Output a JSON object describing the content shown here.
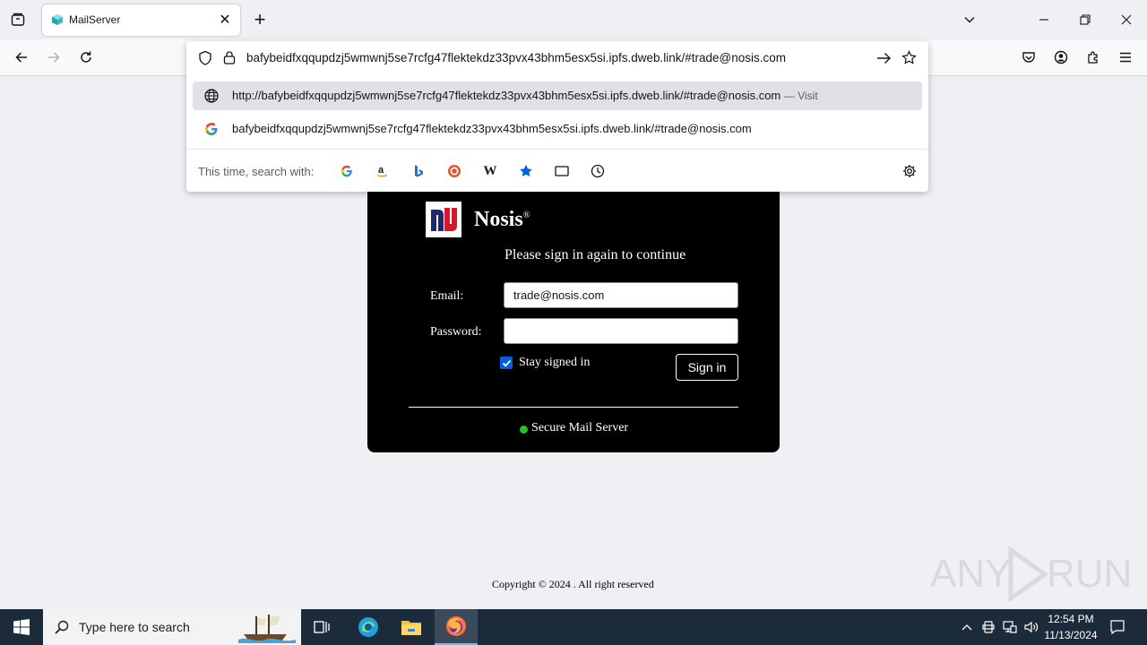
{
  "browser": {
    "tab": {
      "title": "MailServer",
      "close_glyph": "✕"
    },
    "new_tab_glyph": "+",
    "url": "bafybeidfxqqupdzj5wmwnj5se7rcfg47flektekdz33pvx43bhm5esx5si.ipfs.dweb.link/#trade@nosis.com",
    "suggestions": [
      {
        "text": "http://bafybeidfxqqupdzj5wmwnj5se7rcfg47flektekdz33pvx43bhm5esx5si.ipfs.dweb.link/#trade@nosis.com",
        "action": "— Visit",
        "icon": "globe-icon"
      },
      {
        "text": "bafybeidfxqqupdzj5wmwnj5se7rcfg47flektekdz33pvx43bhm5esx5si.ipfs.dweb.link/#trade@nosis.com",
        "icon": "google-icon"
      }
    ],
    "search_with_label": "This time, search with:",
    "search_engines": [
      "google-icon",
      "amazon-icon",
      "bing-icon",
      "duckduckgo-icon",
      "wikipedia-icon",
      "bookmarks-icon",
      "tabs-icon",
      "history-icon"
    ],
    "wikipedia_glyph": "W"
  },
  "page": {
    "brand": "Nosis",
    "brand_mark": "®",
    "subtitle": "Please sign in again to continue",
    "email_label": "Email:",
    "email_value": "trade@nosis.com",
    "password_label": "Password:",
    "password_value": "",
    "stay_signed_in_label": "Stay signed in",
    "stay_signed_in_checked": true,
    "signin_label": "Sign in",
    "secure_text": "Secure Mail Server",
    "secure_color": "#22c322",
    "copyright": "Copyright © 2024 . All right reserved"
  },
  "watermark": {
    "left": "ANY",
    "right": "RUN"
  },
  "taskbar": {
    "search_placeholder": "Type here to search",
    "time": "12:54 PM",
    "date": "11/13/2024"
  },
  "colors": {
    "accent": "#0060df",
    "card": "#000000",
    "taskbar": "#1c2b3a"
  }
}
